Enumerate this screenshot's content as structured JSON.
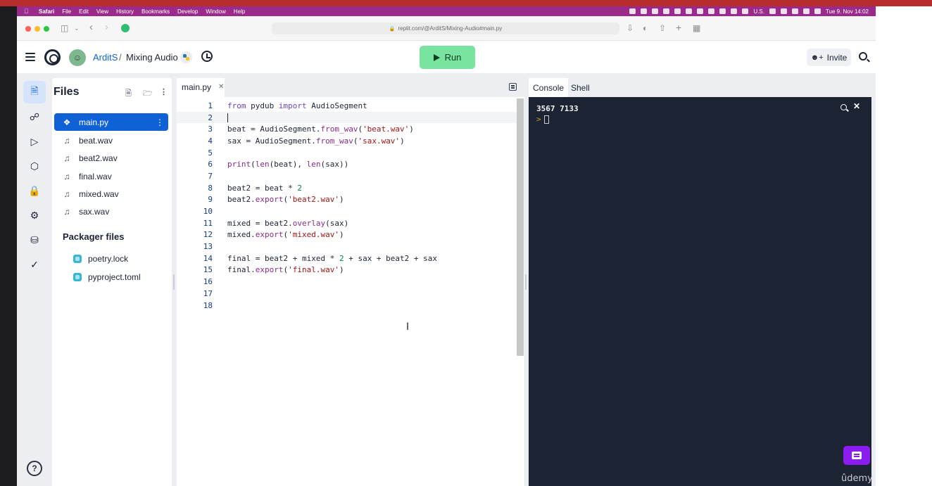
{
  "menubar": {
    "app": "Safari",
    "items": [
      "File",
      "Edit",
      "View",
      "History",
      "Bookmarks",
      "Develop",
      "Window",
      "Help"
    ],
    "input_source": "U.S.",
    "clock": "Tue 9. Nov 14:02"
  },
  "browser": {
    "url": "replit.com/@ArditS/Mixing-Audio#main.py"
  },
  "header": {
    "user": "ArditS",
    "separator": "/",
    "project": "Mixing Audio",
    "run_label": "Run",
    "invite_label": "Invite"
  },
  "files": {
    "title": "Files",
    "items": [
      {
        "name": "main.py",
        "icon": "python-icon"
      },
      {
        "name": "beat.wav",
        "icon": "music-note-icon"
      },
      {
        "name": "beat2.wav",
        "icon": "music-note-icon"
      },
      {
        "name": "final.wav",
        "icon": "music-note-icon"
      },
      {
        "name": "mixed.wav",
        "icon": "music-note-icon"
      },
      {
        "name": "sax.wav",
        "icon": "music-note-icon"
      }
    ],
    "packager_title": "Packager files",
    "packager_items": [
      "poetry.lock",
      "pyproject.toml"
    ]
  },
  "editor": {
    "tab": "main.py",
    "line_numbers": [
      "1",
      "2",
      "3",
      "4",
      "5",
      "6",
      "7",
      "8",
      "9",
      "10",
      "11",
      "12",
      "13",
      "14",
      "15",
      "16",
      "17",
      "18"
    ]
  },
  "console": {
    "tabs": [
      "Console",
      "Shell"
    ],
    "output": "3567 7133",
    "prompt": ">"
  },
  "watermark": "ûdemy"
}
